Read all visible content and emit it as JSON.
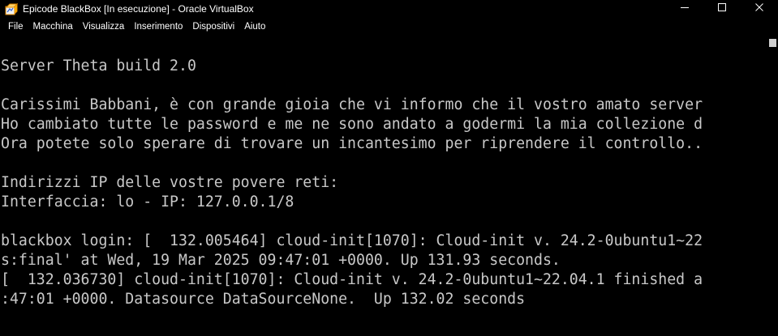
{
  "window": {
    "title": "Epicode BlackBox [In esecuzione] - Oracle VirtualBox",
    "app_icon": "virtualbox-icon",
    "controls": {
      "minimize_icon": "minimize-icon",
      "maximize_icon": "maximize-icon",
      "close_icon": "close-icon"
    }
  },
  "menu": {
    "items": [
      {
        "label": "File"
      },
      {
        "label": "Macchina"
      },
      {
        "label": "Visualizza"
      },
      {
        "label": "Inserimento"
      },
      {
        "label": "Dispositivi"
      },
      {
        "label": "Aiuto"
      }
    ]
  },
  "console": {
    "lines": [
      "Server Theta build 2.0",
      "",
      "Carissimi Babbani, è con grande gioia che vi informo che il vostro amato server",
      "Ho cambiato tutte le password e me ne sono andato a godermi la mia collezione d",
      "Ora potete solo sperare di trovare un incantesimo per riprendere il controllo..",
      "",
      "Indirizzi IP delle vostre povere reti:",
      "Interfaccia: lo - IP: 127.0.0.1/8",
      "",
      "blackbox login: [  132.005464] cloud-init[1070]: Cloud-init v. 24.2-0ubuntu1~22",
      "s:final' at Wed, 19 Mar 2025 09:47:01 +0000. Up 131.93 seconds.",
      "[  132.036730] cloud-init[1070]: Cloud-init v. 24.2-0ubuntu1~22.04.1 finished a",
      ":47:01 +0000. Datasource DataSourceNone.  Up 132.02 seconds"
    ]
  },
  "colors": {
    "background": "#000000",
    "console_text": "#c8c8c8",
    "chrome_text": "#ffffff"
  }
}
